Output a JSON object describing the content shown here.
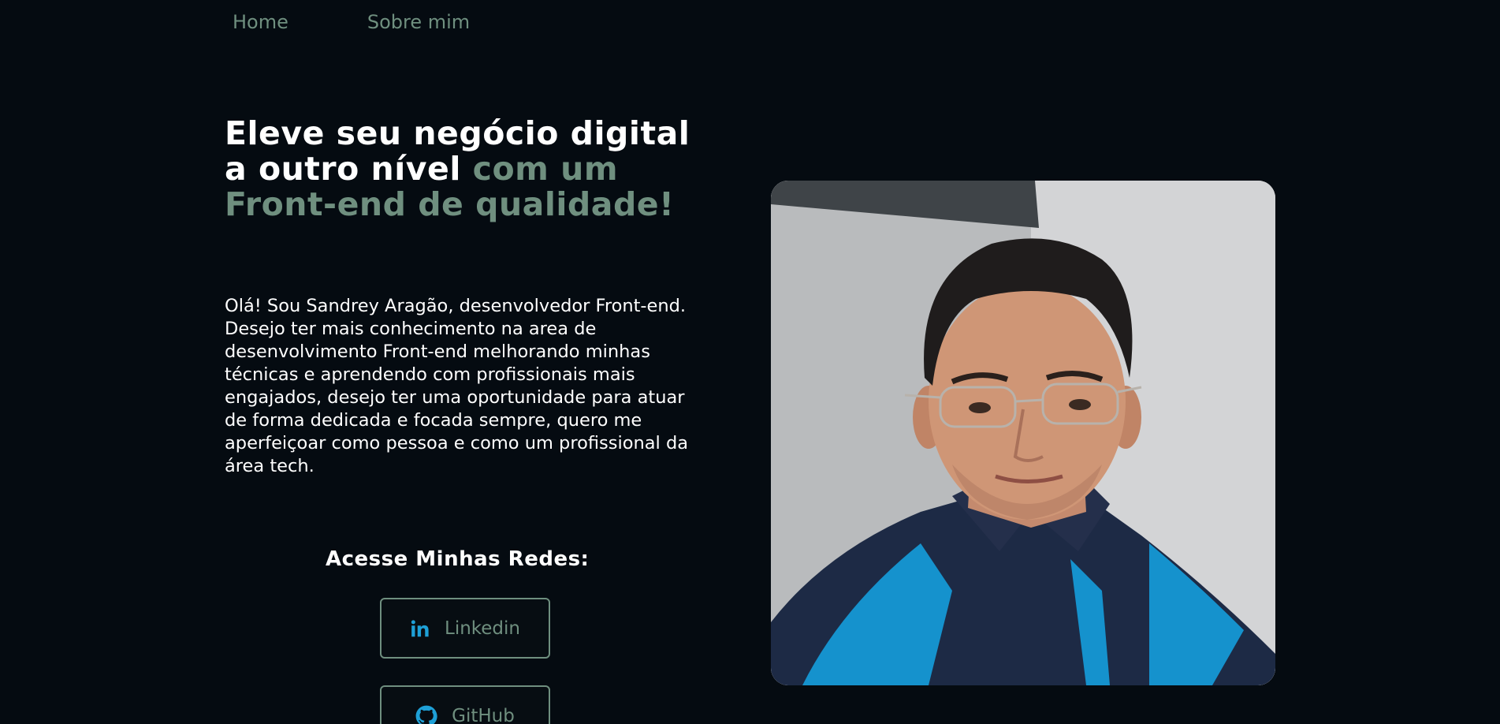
{
  "nav": {
    "home": "Home",
    "about": "Sobre mim"
  },
  "hero": {
    "headline_white": "Eleve seu negócio digital a outro nível",
    "headline_accent": "com um Front-end de qualidade!",
    "bio": "Olá! Sou Sandrey Aragão, desenvolvedor Front-end. Desejo ter mais conhecimento na area de desenvolvimento Front-end melhorando minhas técnicas e aprendendo com profissionais mais engajados, desejo ter uma oportunidade para atuar de forma dedicada e focada sempre, quero me aperfeiçoar como pessoa e como um profissional da área tech."
  },
  "social": {
    "title": "Acesse Minhas Redes:",
    "linkedin_label": "Linkedin",
    "linkedin_icon": "linkedin-icon",
    "github_label": "GitHub",
    "github_icon": "github-icon"
  },
  "colors": {
    "background": "#050b11",
    "accent": "#6f8f7f",
    "icon_blue": "#1ea0d7",
    "text": "#ffffff"
  }
}
